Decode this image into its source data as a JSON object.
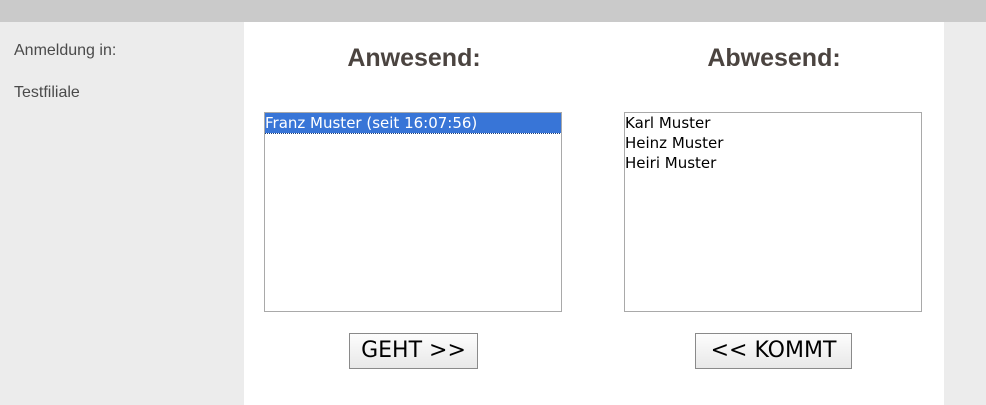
{
  "sidebar": {
    "login_label": "Anmeldung in:",
    "branch_name": "Testfiliale"
  },
  "present": {
    "title": "Anwesend:",
    "items": [
      "Franz Muster (seit 16:07:56)"
    ],
    "selected_index": 0,
    "button_label": "GEHT >>"
  },
  "absent": {
    "title": "Abwesend:",
    "items": [
      "Karl Muster",
      "Heinz Muster",
      "Heiri Muster"
    ],
    "button_label": "<< KOMMT"
  },
  "colors": {
    "selection": "#3875d7",
    "title": "#4b4440",
    "topbar": "#cacaca",
    "background": "#ececec"
  }
}
